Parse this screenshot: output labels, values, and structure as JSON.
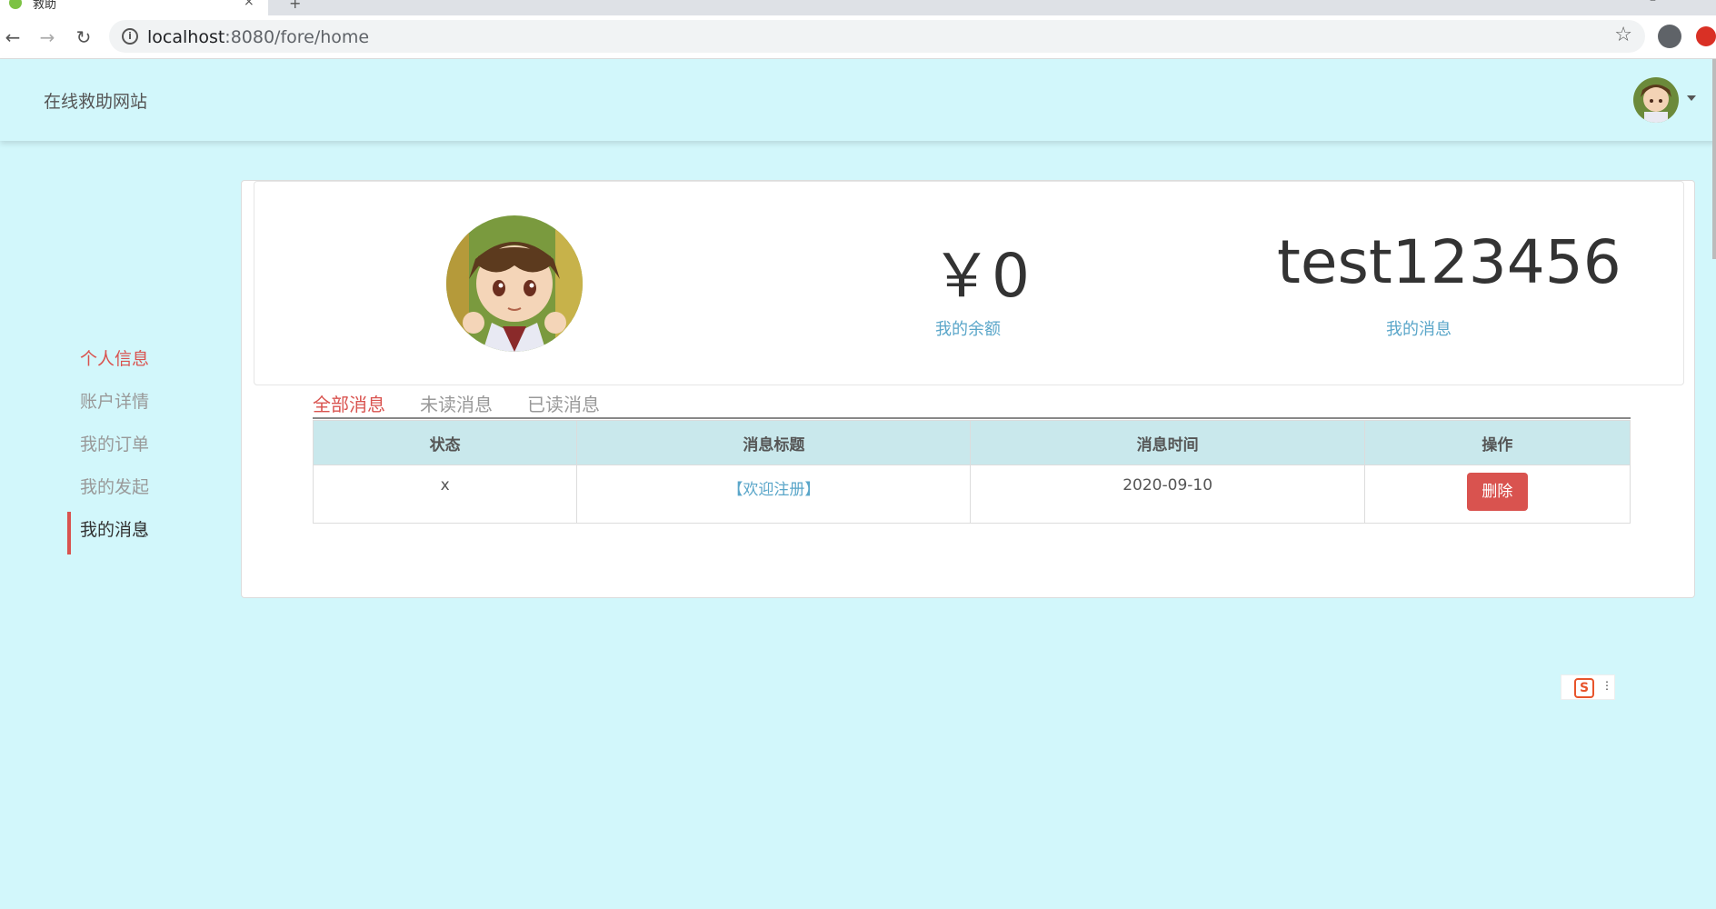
{
  "browser": {
    "tab_title": "救助",
    "url_host": "localhost",
    "url_rest": ":8080/fore/home",
    "new_tab": "+",
    "close_glyph": "×"
  },
  "header": {
    "site_title": "在线救助网站"
  },
  "sidebar": {
    "items": [
      {
        "label": "个人信息"
      },
      {
        "label": "账户详情"
      },
      {
        "label": "我的订单"
      },
      {
        "label": "我的发起"
      },
      {
        "label": "我的消息"
      }
    ]
  },
  "summary": {
    "balance": "￥0",
    "balance_label": "我的余额",
    "username": "test123456",
    "messages_label": "我的消息"
  },
  "tabs": [
    "全部消息",
    "未读消息",
    "已读消息"
  ],
  "table": {
    "headers": [
      "状态",
      "消息标题",
      "消息时间",
      "操作"
    ],
    "rows": [
      {
        "status": "x",
        "title": "【欢迎注册】",
        "time": "2020-09-10",
        "action": "删除"
      }
    ]
  },
  "ime": {
    "logo": "S"
  }
}
